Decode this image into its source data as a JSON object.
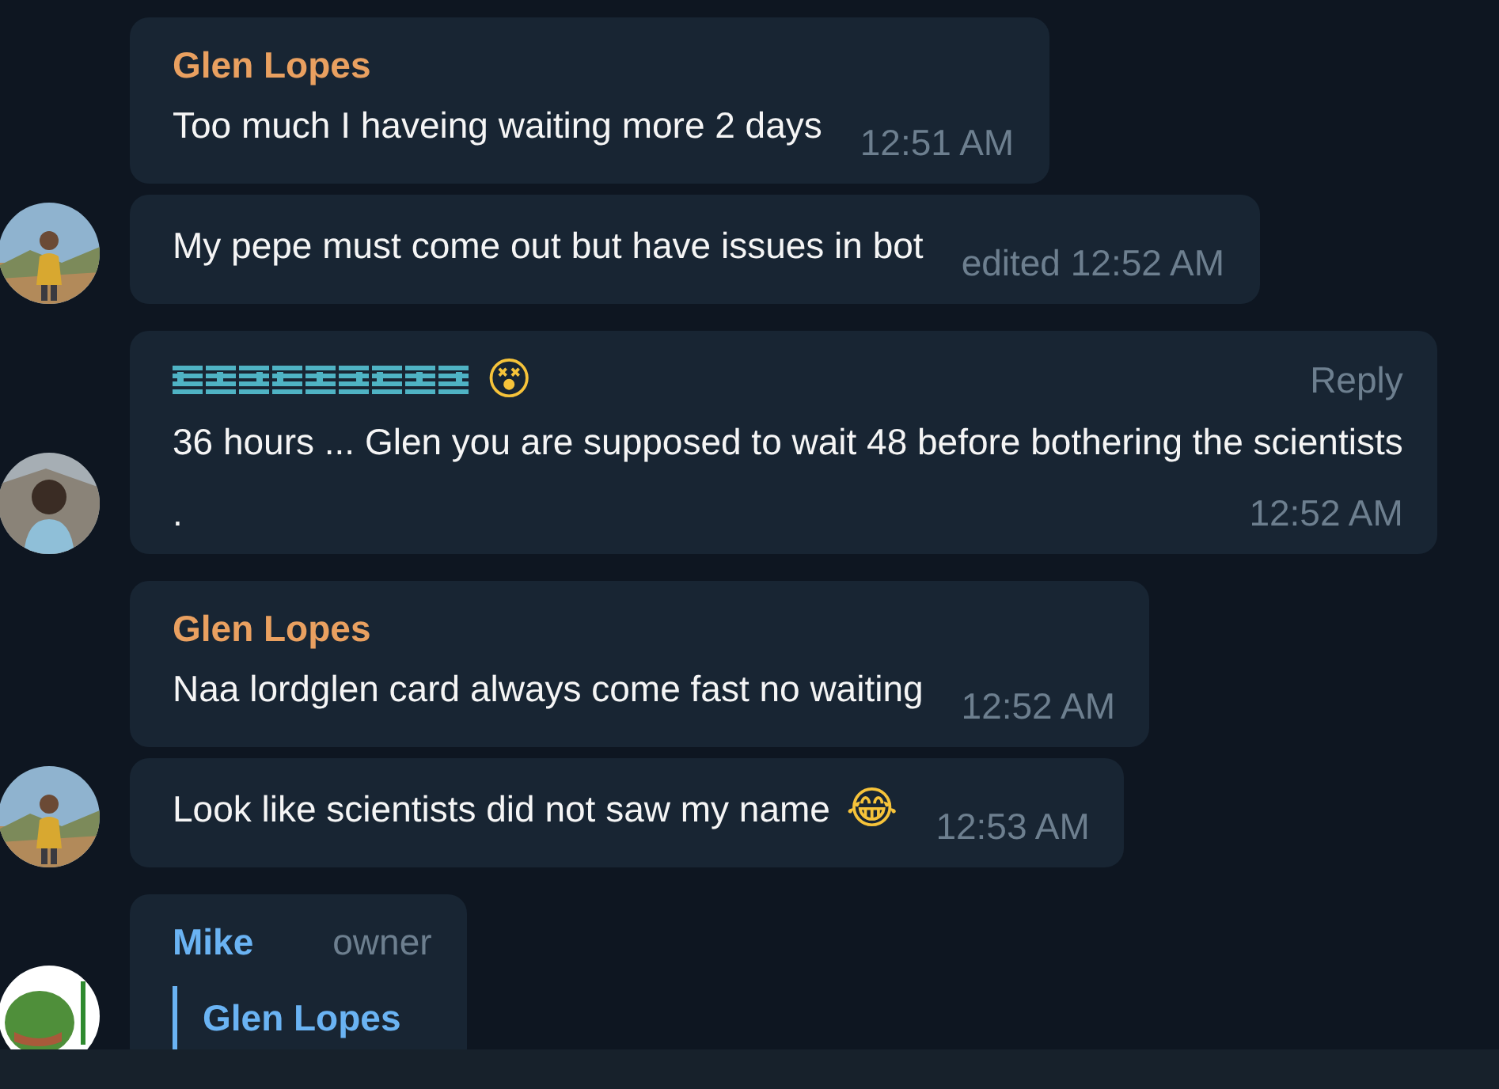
{
  "messages": [
    {
      "kind": "named",
      "name": "Glen Lopes",
      "color": "#e9a060",
      "text": "Too much I haveing waiting more 2 days",
      "time": "12:51 AM"
    },
    {
      "kind": "plain",
      "text": "My pepe must come out but have issues in bot",
      "time": "edited 12:52 AM"
    },
    {
      "kind": "garbled_name",
      "color": "#4fb3c4",
      "name_emoji": "😵",
      "badge": "Reply",
      "text": "36 hours ... Glen you are supposed to wait 48 before bothering the scientists",
      "tail": ".",
      "time": "12:52 AM"
    },
    {
      "kind": "named",
      "name": "Glen Lopes",
      "color": "#e9a060",
      "text": "Naa lordglen card always come fast no waiting",
      "time": "12:52 AM"
    },
    {
      "kind": "plain",
      "text": "Look like scientists did not saw my name",
      "emoji": "😂",
      "time": "12:53 AM"
    },
    {
      "kind": "named",
      "name": "Mike",
      "color": "#6ab3f3",
      "badge": "owner",
      "reply_to": "Glen Lopes"
    }
  ]
}
